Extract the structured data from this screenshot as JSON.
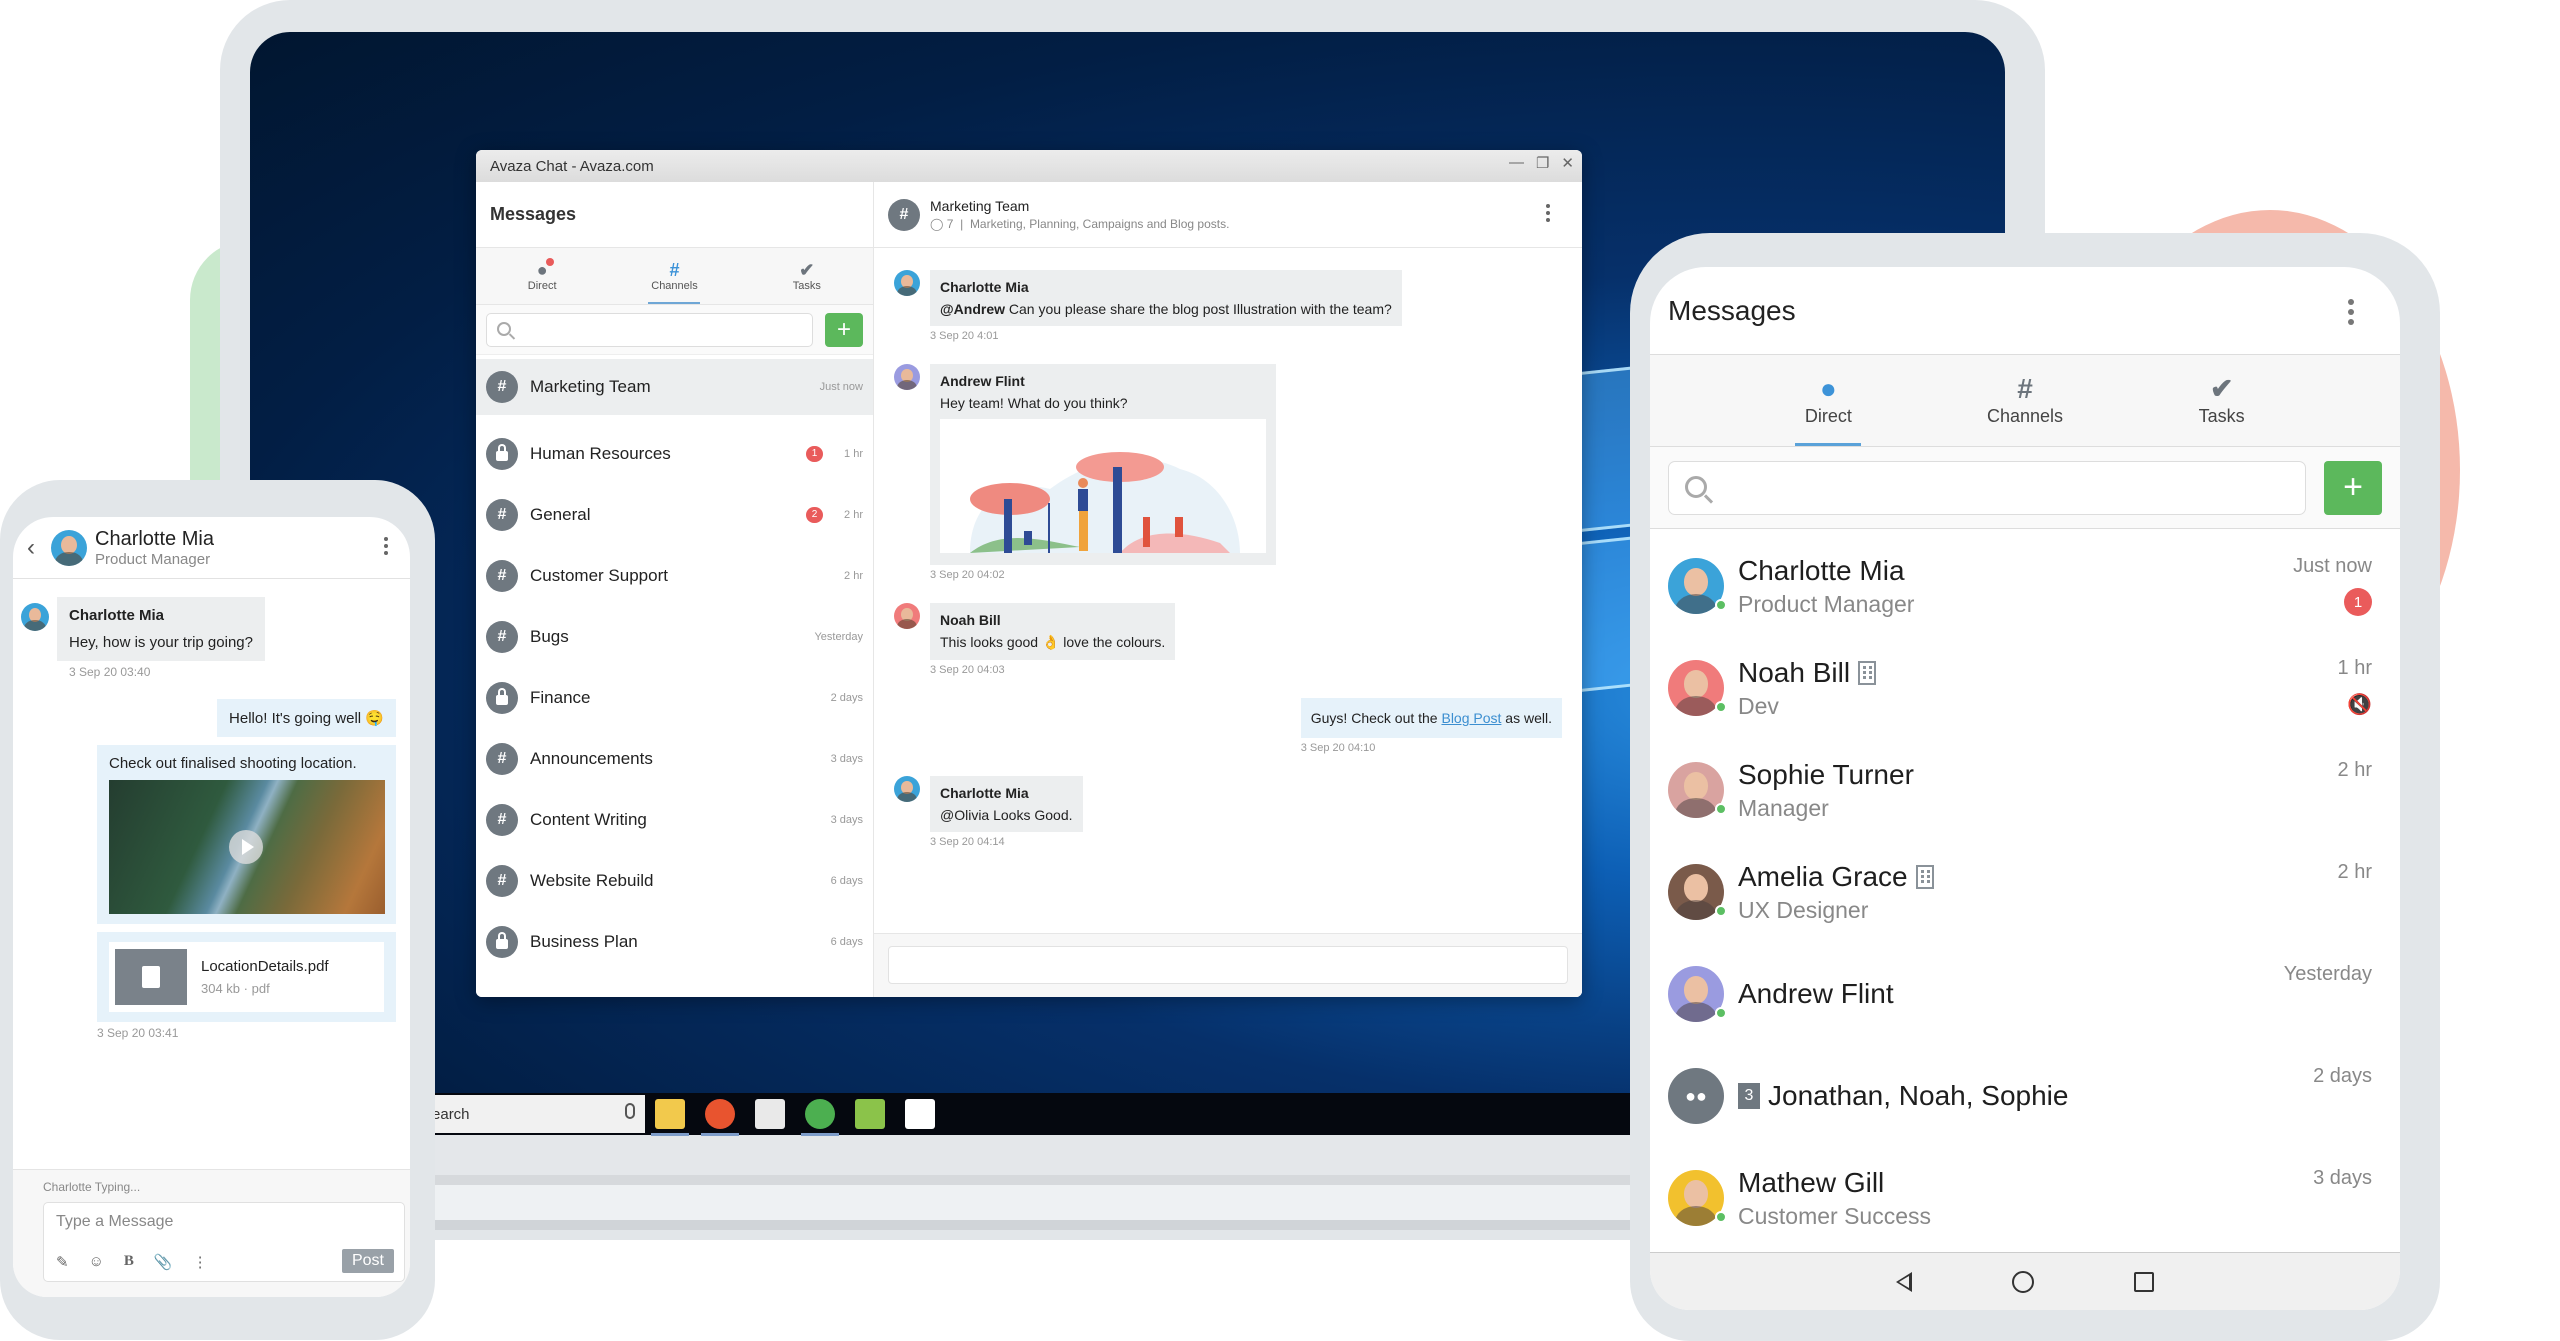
{
  "desktop_window": {
    "title": "Avaza Chat - Avaza.com",
    "controls": [
      "minimize",
      "restore",
      "close"
    ],
    "sidebar": {
      "title": "Messages",
      "tabs": [
        {
          "label": "Direct",
          "icon": "users-icon",
          "has_notification": true,
          "active": false
        },
        {
          "label": "Channels",
          "icon": "hash-icon",
          "active": true
        },
        {
          "label": "Tasks",
          "icon": "check-circle-icon",
          "active": false
        }
      ],
      "search_placeholder": "",
      "add_label": "+",
      "channels": [
        {
          "name": "Marketing Team",
          "type": "public",
          "time": "Just now",
          "badge": null,
          "active": true
        },
        {
          "name": "Human Resources",
          "type": "private",
          "time": "1 hr",
          "badge": "1"
        },
        {
          "name": "General",
          "type": "public",
          "time": "2 hr",
          "badge": "2"
        },
        {
          "name": "Customer Support",
          "type": "public",
          "time": "2 hr",
          "badge": null
        },
        {
          "name": "Bugs",
          "type": "public",
          "time": "Yesterday",
          "badge": null
        },
        {
          "name": "Finance",
          "type": "private",
          "time": "2 days",
          "badge": null
        },
        {
          "name": "Announcements",
          "type": "public",
          "time": "3 days",
          "badge": null
        },
        {
          "name": "Content Writing",
          "type": "public",
          "time": "3 days",
          "badge": null
        },
        {
          "name": "Website Rebuild",
          "type": "public",
          "time": "6 days",
          "badge": null
        },
        {
          "name": "Business Plan",
          "type": "private",
          "time": "6 days",
          "badge": null
        }
      ]
    },
    "chat": {
      "channel_name": "Marketing Team",
      "member_count": "7",
      "separator": "|",
      "description": "Marketing, Planning, Campaigns and Blog posts.",
      "messages": [
        {
          "author": "Charlotte Mia",
          "mention": "@Andrew",
          "text": " Can you please share the blog  post Illustration with the team?",
          "time": "3 Sep 20 4:01"
        },
        {
          "author": "Andrew Flint",
          "text": "Hey team! What do you think?",
          "has_image": true,
          "time": "3 Sep 20 04:02"
        },
        {
          "author": "Noah Bill",
          "text_before": "This looks good ",
          "emoji": "👌",
          "text_after": " love the colours.",
          "time": "3 Sep 20 04:03"
        },
        {
          "mine": true,
          "text_before": "Guys! Check out the ",
          "link": "Blog Post",
          "text_after": " as well.",
          "time": "3 Sep 20 04:10"
        },
        {
          "author": "Charlotte Mia",
          "text": "@Olivia Looks Good.",
          "time": "3 Sep 20 04:14"
        }
      ],
      "input_placeholder": ""
    }
  },
  "taskbar": {
    "search_text": "Search",
    "apps": [
      {
        "name": "file-explorer",
        "active": true,
        "color": "#f2c94c"
      },
      {
        "name": "firefox",
        "active": true,
        "color": "#e8542f"
      },
      {
        "name": "calculator",
        "active": false,
        "color": "#e9e9e9"
      },
      {
        "name": "chrome",
        "active": true,
        "color": "#4caf50"
      },
      {
        "name": "notepad",
        "active": false,
        "color": "#8bc34a"
      },
      {
        "name": "evernote",
        "active": false,
        "color": "#ffffff"
      }
    ]
  },
  "left_phone": {
    "contact_name": "Charlotte Mia",
    "contact_role": "Product Manager",
    "messages": [
      {
        "author": "Charlotte Mia",
        "text": "Hey, how is your trip going?",
        "time": "3 Sep 20 03:40"
      },
      {
        "mine": true,
        "text": "Hello! It's going well",
        "emoji": "🤤"
      },
      {
        "mine": true,
        "text": "Check out finalised shooting location.",
        "has_video": true
      },
      {
        "mine": true,
        "file_name": "LocationDetails.pdf",
        "file_size": "304 kb",
        "file_type": "pdf",
        "time": "3 Sep 20 03:41"
      }
    ],
    "typing_status": "Charlotte Typing...",
    "input_placeholder": "Type a Message",
    "post_label": "Post",
    "tool_icons": [
      "edit-icon",
      "emoji-icon",
      "bold-icon",
      "attach-icon",
      "more-icon"
    ]
  },
  "right_phone": {
    "title": "Messages",
    "tabs": [
      {
        "label": "Direct",
        "active": true
      },
      {
        "label": "Channels",
        "active": false
      },
      {
        "label": "Tasks",
        "active": false
      }
    ],
    "add_label": "+",
    "contacts": [
      {
        "name": "Charlotte Mia",
        "role": "Product Manager",
        "time": "Just now",
        "badge": "1",
        "online": true,
        "avatar_bg": "#3ba3d9"
      },
      {
        "name": "Noah Bill",
        "role": "Dev",
        "time": "1 hr",
        "muted": true,
        "external": true,
        "online": true,
        "avatar_bg": "#f07b7b"
      },
      {
        "name": "Sophie Turner",
        "role": "Manager",
        "time": "2 hr",
        "online": true,
        "avatar_bg": "#d9a3a0"
      },
      {
        "name": "Amelia Grace",
        "role": "UX Designer",
        "time": "2 hr",
        "external": true,
        "online": true,
        "avatar_bg": "#7a5a4a"
      },
      {
        "name": "Andrew Flint",
        "role": "",
        "time": "Yesterday",
        "online": true,
        "avatar_bg": "#9a9be0"
      },
      {
        "name": "Jonathan, Noah, Sophie",
        "group_count": "3",
        "role": "",
        "time": "2 days",
        "group": true
      },
      {
        "name": "Mathew Gill",
        "role": "Customer Success",
        "time": "3 days",
        "online": true,
        "avatar_bg": "#f2c12e"
      }
    ]
  },
  "colors": {
    "accent_blue": "#3d93d8",
    "add_green": "#5cb85c",
    "badge_red": "#e95b5b",
    "online_green": "#5cbf63"
  }
}
